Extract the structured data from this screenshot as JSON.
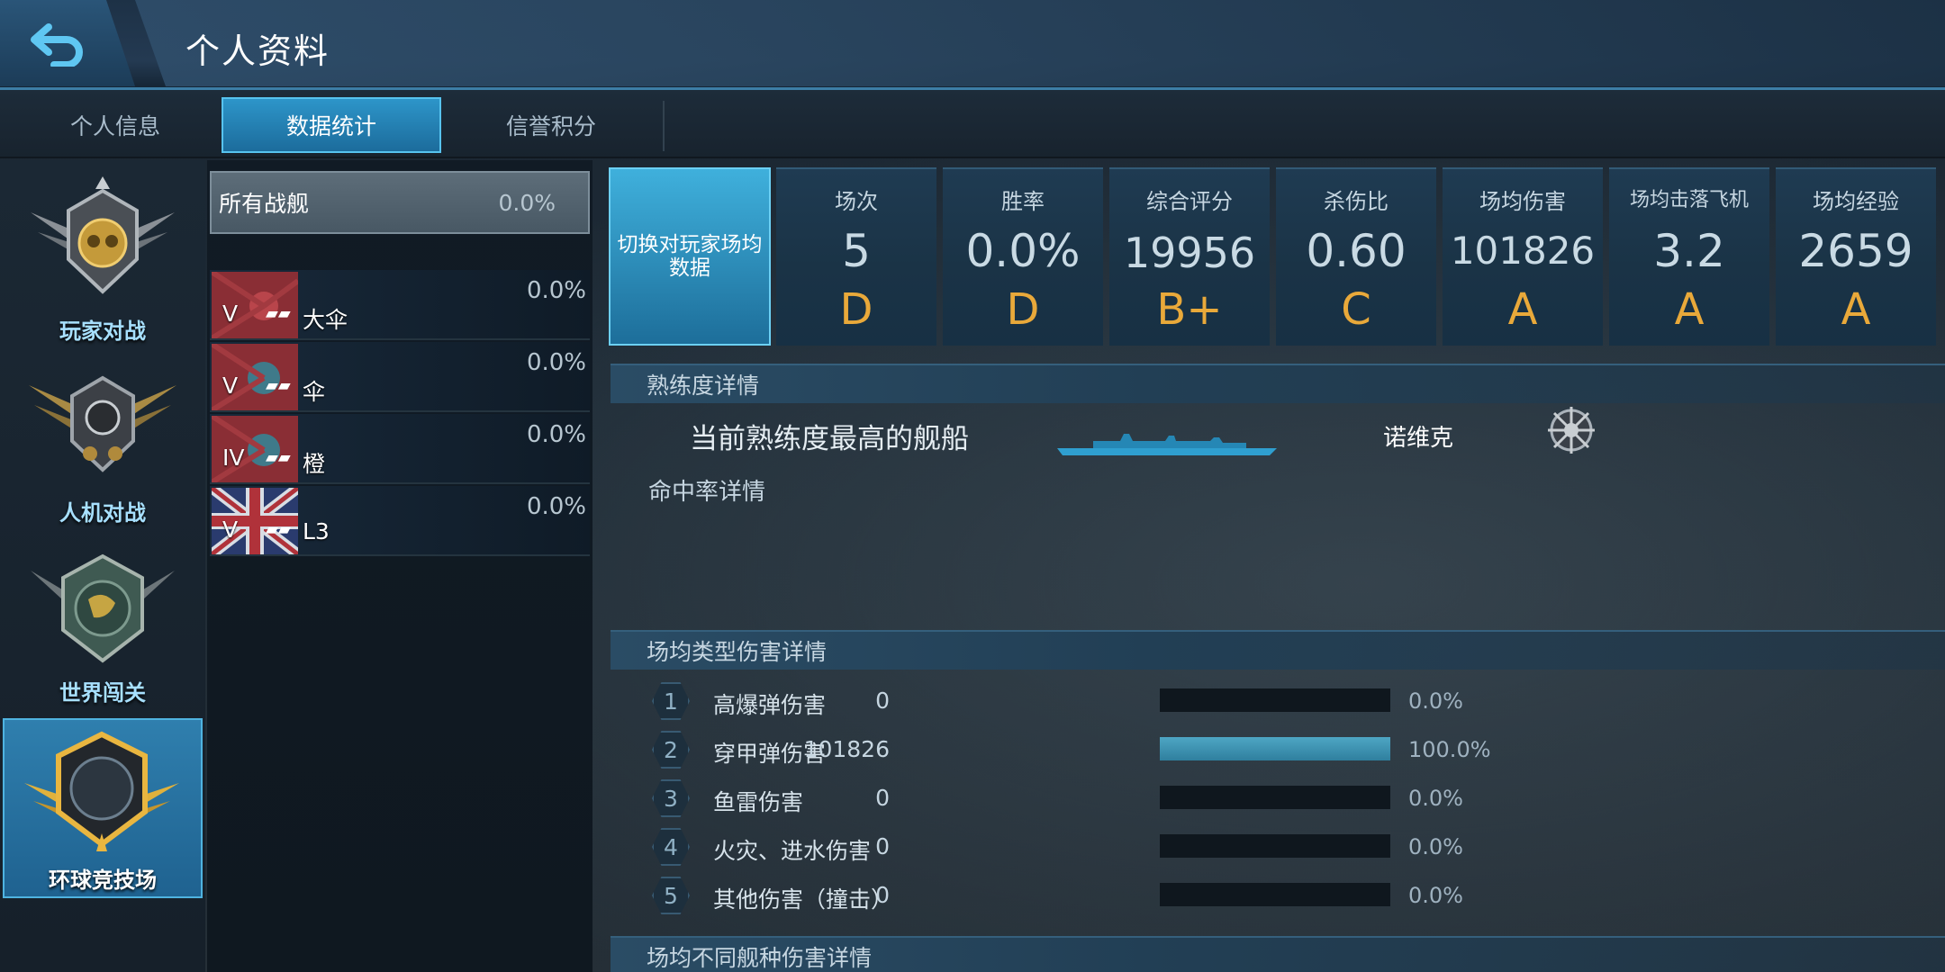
{
  "header": {
    "title": "个人资料"
  },
  "tabs": [
    {
      "label": "个人信息",
      "active": false
    },
    {
      "label": "数据统计",
      "active": true
    },
    {
      "label": "信誉积分",
      "active": false
    }
  ],
  "modes": [
    {
      "label": "玩家对战",
      "active": false,
      "icon": "pvp-emblem-icon"
    },
    {
      "label": "人机对战",
      "active": false,
      "icon": "pve-emblem-icon"
    },
    {
      "label": "世界闯关",
      "active": false,
      "icon": "world-emblem-icon"
    },
    {
      "label": "环球竞技场",
      "active": true,
      "icon": "arena-emblem-icon"
    }
  ],
  "ship_list": {
    "all": {
      "label": "所有战舰",
      "pct": "0.0%"
    },
    "ships": [
      {
        "tier": "V",
        "name": "大伞",
        "pct": "0.0%",
        "flag": "japan-flag-icon"
      },
      {
        "tier": "V",
        "name": "伞",
        "pct": "0.0%",
        "flag": "japan-flag-icon"
      },
      {
        "tier": "IV",
        "name": "橙",
        "pct": "0.0%",
        "flag": "japan-flag-icon"
      },
      {
        "tier": "V",
        "name": "L3",
        "pct": "0.0%",
        "flag": "uk-flag-icon"
      }
    ]
  },
  "stats": {
    "toggle_label": "切换对玩家场均数据",
    "items": [
      {
        "label": "场次",
        "value": "5",
        "grade": "D"
      },
      {
        "label": "胜率",
        "value": "0.0%",
        "grade": "D"
      },
      {
        "label": "综合评分",
        "value": "19956",
        "grade": "B+"
      },
      {
        "label": "杀伤比",
        "value": "0.60",
        "grade": "C"
      },
      {
        "label": "场均伤害",
        "value": "101826",
        "grade": "A"
      },
      {
        "label": "场均击落飞机",
        "value": "3.2",
        "grade": "A"
      },
      {
        "label": "场均经验",
        "value": "2659",
        "grade": "A"
      }
    ]
  },
  "proficiency": {
    "title": "熟练度详情",
    "best_ship_label": "当前熟练度最高的舰船",
    "best_ship_name": "诺维克",
    "hit_rate_label": "命中率详情"
  },
  "damage_types": {
    "title": "场均类型伤害详情",
    "rows": [
      {
        "num": "1",
        "name": "高爆弹伤害",
        "value": "0",
        "pct": "0.0%",
        "fraction": 0
      },
      {
        "num": "2",
        "name": "穿甲弹伤害",
        "value": "101826",
        "pct": "100.0%",
        "fraction": 1
      },
      {
        "num": "3",
        "name": "鱼雷伤害",
        "value": "0",
        "pct": "0.0%",
        "fraction": 0
      },
      {
        "num": "4",
        "name": "火灾、进水伤害",
        "value": "0",
        "pct": "0.0%",
        "fraction": 0
      },
      {
        "num": "5",
        "name": "其他伤害（撞击）",
        "value": "0",
        "pct": "0.0%",
        "fraction": 0
      }
    ]
  },
  "ship_class_damage": {
    "title": "场均不同舰种伤害详情"
  },
  "colors": {
    "accent": "#2d95c9",
    "grade": "#e9a93a",
    "bar": "#4ea6c4"
  }
}
